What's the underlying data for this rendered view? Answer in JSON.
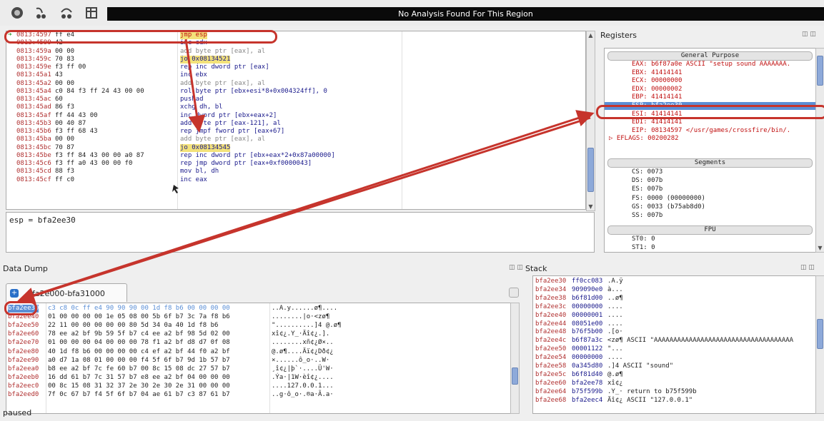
{
  "toolbar": {
    "buttons": [
      {
        "name": "run-button",
        "icon": "run-icon"
      },
      {
        "name": "step-into-button",
        "icon": "step-into-icon"
      },
      {
        "name": "step-over-button",
        "icon": "step-over-icon"
      },
      {
        "name": "view-button",
        "icon": "view-icon"
      }
    ],
    "analysis_text": "No Analysis Found For This Region"
  },
  "disassembly": {
    "rows": [
      {
        "addr": "0813:4597",
        "bytes": "ff e4",
        "instr": "jmp esp",
        "style": "red",
        "current": true
      },
      {
        "addr": "0813:4599",
        "bytes": "42",
        "instr": "inc edx",
        "style": ""
      },
      {
        "addr": "0813:459a",
        "bytes": "00 00",
        "instr": "add byte ptr [eax], al",
        "style": "dim"
      },
      {
        "addr": "0813:459c",
        "bytes": "70 83",
        "instr": "jo 0x08134521",
        "style": ""
      },
      {
        "addr": "0813:459e",
        "bytes": "f3 ff 00",
        "instr": "rep inc dword ptr [eax]",
        "style": ""
      },
      {
        "addr": "0813:45a1",
        "bytes": "43",
        "instr": "inc ebx",
        "style": ""
      },
      {
        "addr": "0813:45a2",
        "bytes": "00 00",
        "instr": "add byte ptr [eax], al",
        "style": "dim"
      },
      {
        "addr": "0813:45a4",
        "bytes": "c0 84 f3 ff 24 43 00 00",
        "instr": "rol byte ptr [ebx+esi*8+0x004324ff], 0",
        "style": ""
      },
      {
        "addr": "0813:45ac",
        "bytes": "60",
        "instr": "pushad",
        "style": ""
      },
      {
        "addr": "0813:45ad",
        "bytes": "86 f3",
        "instr": "xchg dh, bl",
        "style": ""
      },
      {
        "addr": "0813:45af",
        "bytes": "ff 44 43 00",
        "instr": "inc dword ptr [ebx+eax+2]",
        "style": ""
      },
      {
        "addr": "0813:45b3",
        "bytes": "00 40 87",
        "instr": "add byte ptr [eax-121], al",
        "style": ""
      },
      {
        "addr": "0813:45b6",
        "bytes": "f3 ff 68 43",
        "instr": "rep jmpf fword ptr [eax+67]",
        "style": ""
      },
      {
        "addr": "0813:45ba",
        "bytes": "00 00",
        "instr": "add byte ptr [eax], al",
        "style": "dim"
      },
      {
        "addr": "0813:45bc",
        "bytes": "70 87",
        "instr": "jo 0x08134545",
        "style": ""
      },
      {
        "addr": "0813:45be",
        "bytes": "f3 ff 84 43 00 00 a0 87",
        "instr": "rep inc dword ptr [ebx+eax*2+0x87a00000]",
        "style": ""
      },
      {
        "addr": "0813:45c6",
        "bytes": "f3 ff a0 43 00 00 f0",
        "instr": "rep jmp dword ptr [eax+0xf0000043]",
        "style": ""
      },
      {
        "addr": "0813:45cd",
        "bytes": "88 f3",
        "instr": "mov bl, dh",
        "style": ""
      },
      {
        "addr": "0813:45cf",
        "bytes": "ff c0",
        "instr": "inc eax",
        "style": ""
      }
    ],
    "expression": "esp = bfa2ee30"
  },
  "registers": {
    "title": "Registers",
    "icons": "◫ ◫",
    "general_label": "General Purpose",
    "general": [
      {
        "text": "EAX: b6f87a0e ASCII \"setup sound AAAAAAA.",
        "selected": false
      },
      {
        "text": "EBX: 41414141",
        "selected": false
      },
      {
        "text": "ECX: 00000000",
        "selected": false
      },
      {
        "text": "EDX: 00000002",
        "selected": false
      },
      {
        "text": "EBP: 41414141",
        "selected": false
      },
      {
        "text": "ESP: bfa2ee30",
        "selected": true
      },
      {
        "text": "ESI: 41414141",
        "selected": false
      },
      {
        "text": "EDI: 41414141",
        "selected": false
      },
      {
        "text": "EIP: 08134597 </usr/games/crossfire/bin/.",
        "selected": false
      },
      {
        "text": "▷ EFLAGS: 00200282",
        "selected": false
      }
    ],
    "segments_label": "Segments",
    "segments": [
      "CS: 0073",
      "DS: 007b",
      "ES: 007b",
      "FS: 0000 (00000000)",
      "GS: 0033 (b75ab8d0)",
      "SS: 007b"
    ],
    "fpu_label": "FPU",
    "fpu": [
      "ST0: 0",
      "ST1: 0"
    ]
  },
  "data_dump": {
    "title": "Data Dump",
    "icons": "◫ ◫",
    "tab_label": "bfa2e000-bfa31000",
    "rows": [
      {
        "addr": "bfa2ee30",
        "hex": "c3 c8 0c ff e4 90 90 90 00 1d f8 b6 00 00 00 00",
        "ascii": "..A.y......ø¶...."
      },
      {
        "addr": "bfa2ee40",
        "hex": "01 00 00 00 00 1e 05 08 00 5b 6f b7 3c 7a f8 b6",
        "ascii": "........|o·<zø¶"
      },
      {
        "addr": "bfa2ee50",
        "hex": "22 11 00 00 00 00 00 80 5d 34 0a 40 1d f8 b6",
        "ascii": "\"..........]4 @.ø¶"
      },
      {
        "addr": "bfa2ee60",
        "hex": "78 ee a2 bf 9b 59 5f b7 c4 ee a2 bf 98 5d 02 00",
        "ascii": "xî¢¿.Y_·Äî¢¿.]."
      },
      {
        "addr": "bfa2ee70",
        "hex": "01 00 00 00 04 00 00 00 78 f1 a2 bf d8 d7 0f 08",
        "ascii": "........xñ¢¿Ø×.."
      },
      {
        "addr": "bfa2ee80",
        "hex": "40 1d f8 b6 00 00 00 00 c4 ef a2 bf 44 f0 a2 bf",
        "ascii": "@.ø¶....Äï¢¿Dð¢¿"
      },
      {
        "addr": "bfa2ee90",
        "hex": "a0 d7 1a 08 01 00 00 00 f4 5f 6f b7 9d 1b 57 b7",
        "ascii": " ×......ô_o·..W·"
      },
      {
        "addr": "bfa2eea0",
        "hex": "b8 ee a2 bf 7c fe 60 b7 00 8c 15 08 dc 27 57 b7",
        "ascii": "¸î¢¿|þ`·....Ü'W·"
      },
      {
        "addr": "bfa2eeb0",
        "hex": "16 dd 61 b7 7c 31 57 b7 e8 ee a2 bf 04 00 00 00",
        "ascii": ".Ýa·|1W·èî¢¿...."
      },
      {
        "addr": "bfa2eec0",
        "hex": "00 8c 15 08 31 32 37 2e 30 2e 30 2e 31 00 00 00",
        "ascii": "....127.0.0.1..."
      },
      {
        "addr": "bfa2eed0",
        "hex": "7f 0c 67 b7 f4 5f 6f b7 04 ae 61 b7 c3 87 61 b7",
        "ascii": "..g·ô_o·.®a·Ã.a·"
      }
    ]
  },
  "stack": {
    "title": "Stack",
    "icons": "◫ ◫",
    "rows": [
      {
        "addr": "bfa2ee30",
        "val": "ff0cc083",
        "comment": ".A.ÿ"
      },
      {
        "addr": "bfa2ee34",
        "val": "909090e0",
        "comment": "à..."
      },
      {
        "addr": "bfa2ee38",
        "val": "b6f81d00",
        "comment": "..ø¶"
      },
      {
        "addr": "bfa2ee3c",
        "val": "00000000",
        "comment": "...."
      },
      {
        "addr": "bfa2ee40",
        "val": "00000001",
        "comment": "...."
      },
      {
        "addr": "bfa2ee44",
        "val": "08051e00",
        "comment": "...."
      },
      {
        "addr": "bfa2ee48",
        "val": "b76f5b00",
        "comment": ".[o·"
      },
      {
        "addr": "bfa2ee4c",
        "val": "b6f87a3c",
        "comment": "<zø¶ ASCII \"AAAAAAAAAAAAAAAAAAAAAAAAAAAAAAAAAAAA"
      },
      {
        "addr": "bfa2ee50",
        "val": "00001122",
        "comment": "\"..."
      },
      {
        "addr": "bfa2ee54",
        "val": "00000000",
        "comment": "...."
      },
      {
        "addr": "bfa2ee58",
        "val": "0a345d80",
        "comment": ".]4 ASCII \"sound\""
      },
      {
        "addr": "bfa2ee5c",
        "val": "b6f81d40",
        "comment": "@.ø¶"
      },
      {
        "addr": "bfa2ee60",
        "val": "bfa2ee78",
        "comment": "xî¢¿"
      },
      {
        "addr": "bfa2ee64",
        "val": "b75f599b",
        "comment": ".Y_· return to b75f599b"
      },
      {
        "addr": "bfa2ee68",
        "val": "bfa2eec4",
        "comment": "Äî¢¿ ASCII \"127.0.0.1\""
      }
    ]
  },
  "status": "paused",
  "colors": {
    "annotation": "#c6342c",
    "address": "#b03030",
    "selection": "#5b8fd6",
    "instr": "#1a1a8c"
  }
}
